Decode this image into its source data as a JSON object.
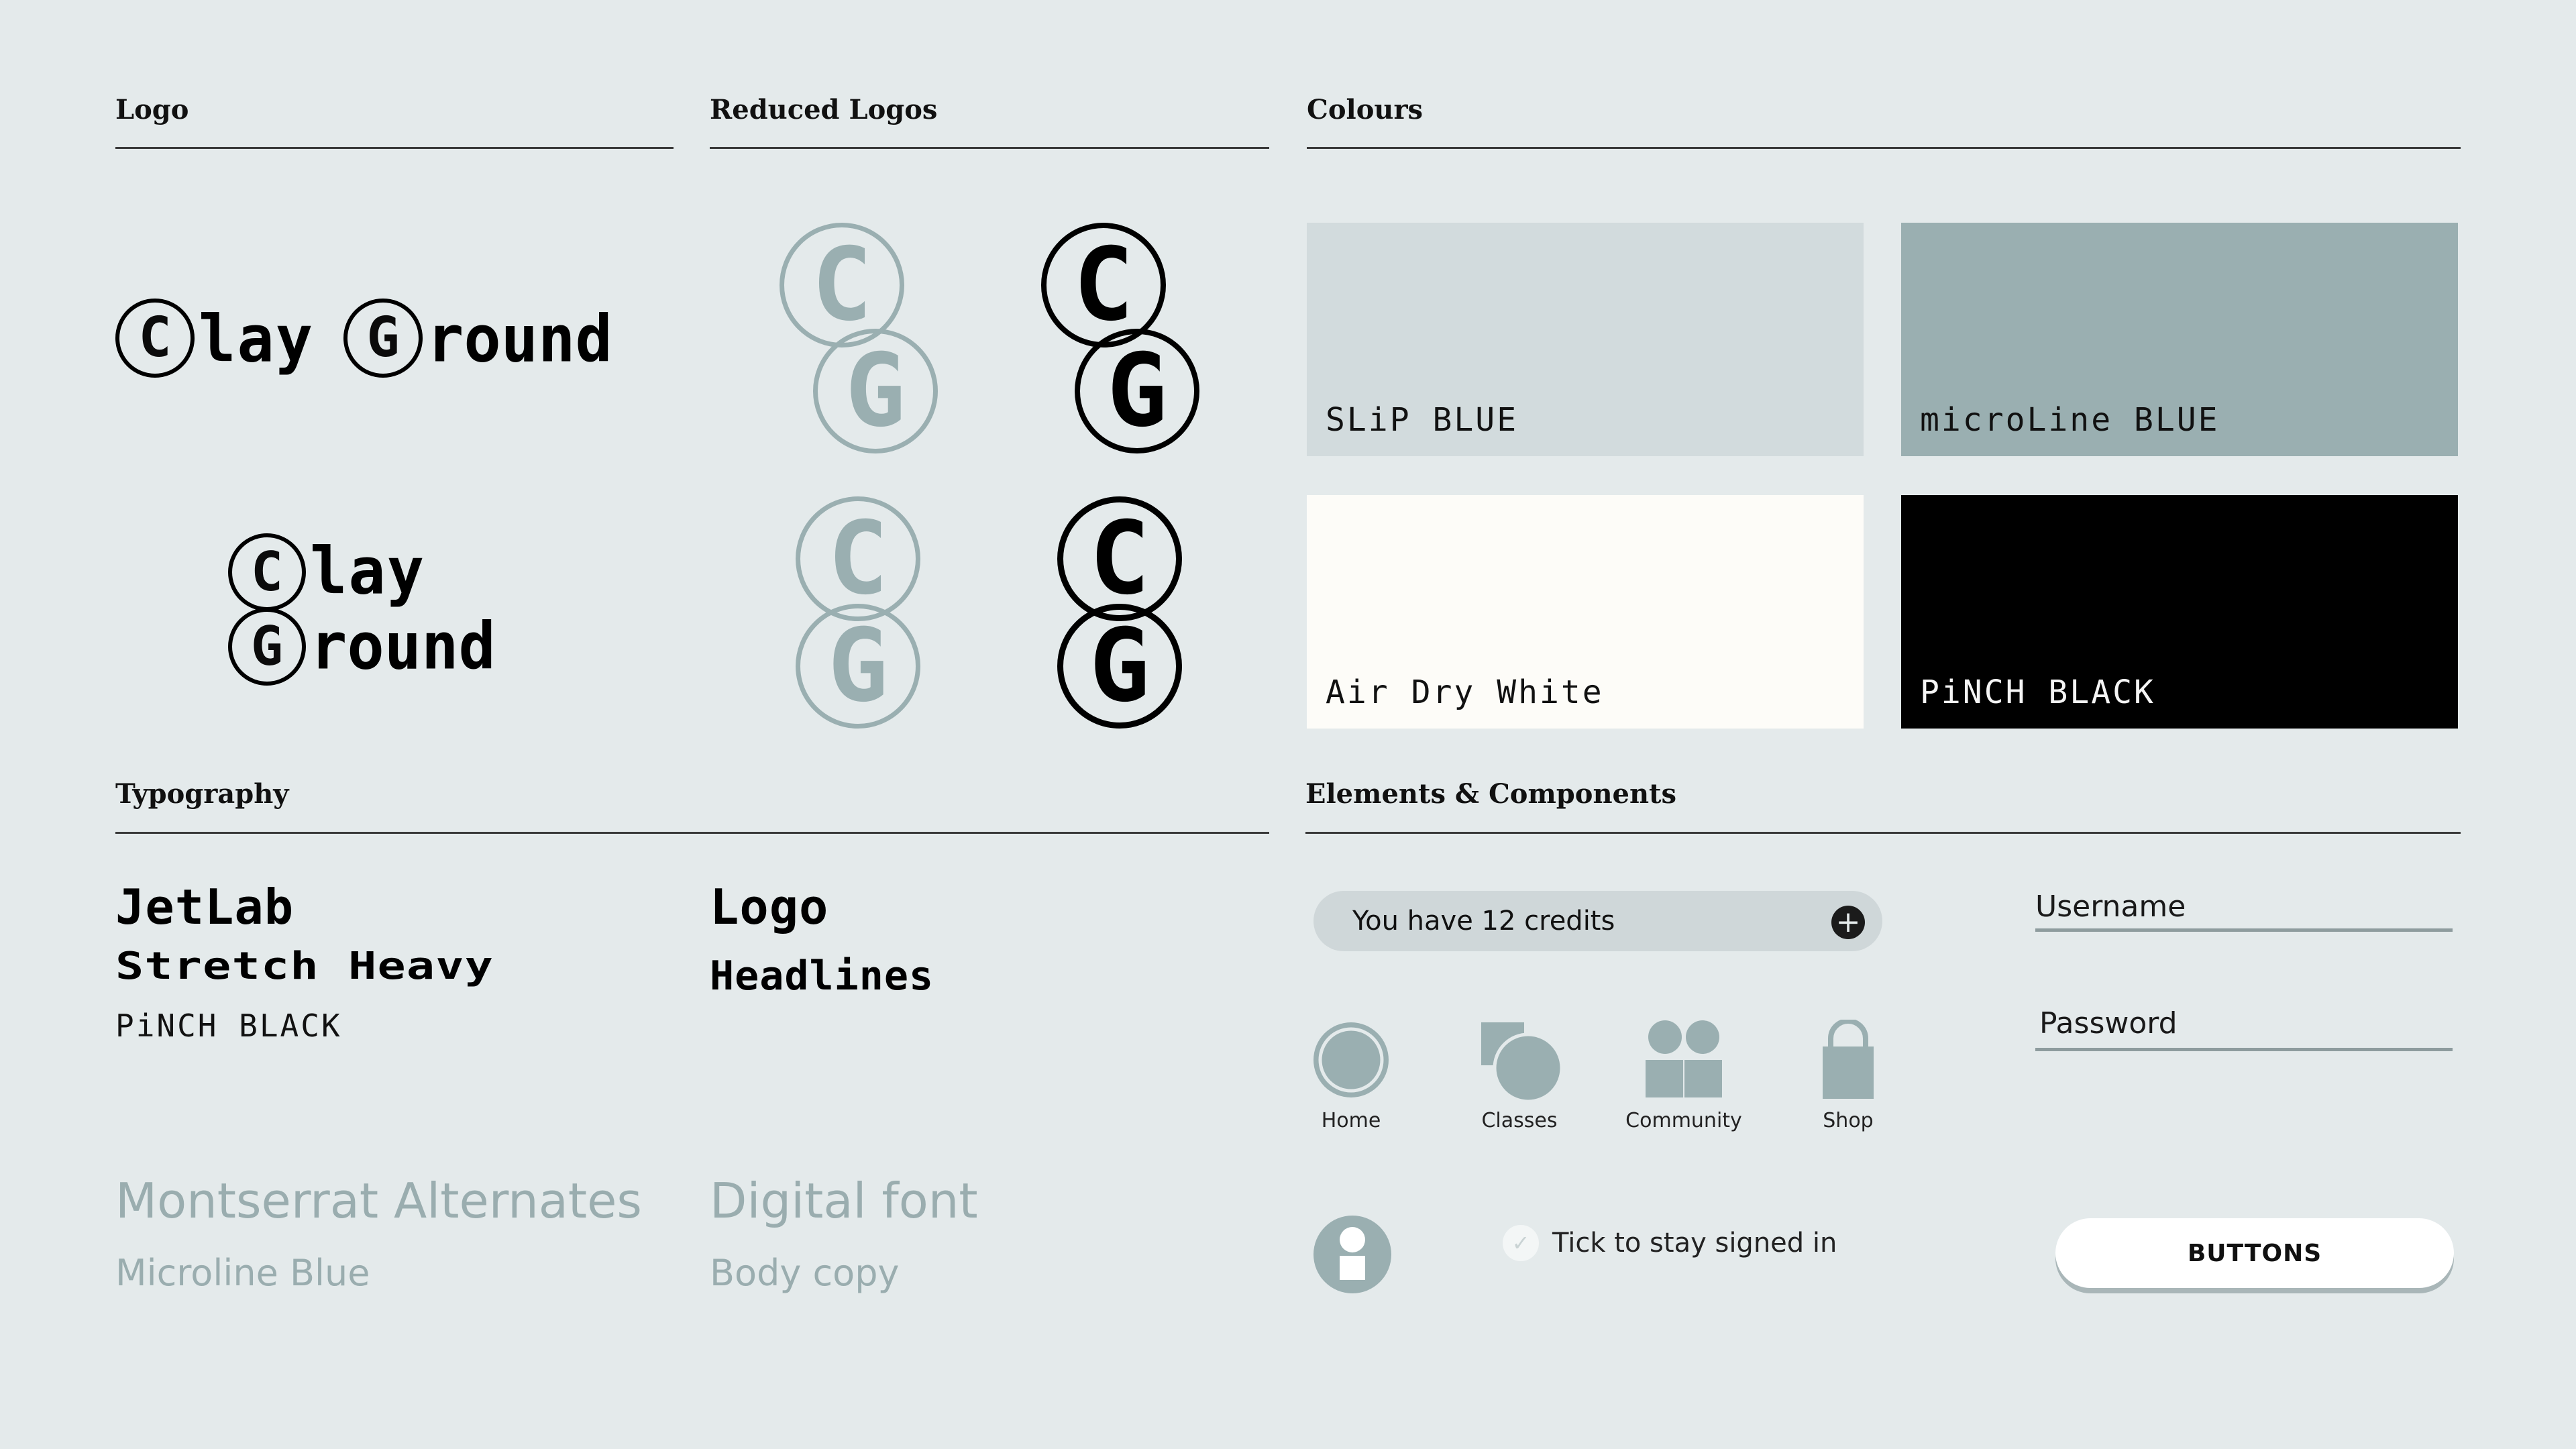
{
  "sections": {
    "logo": "Logo",
    "reduced_logos": "Reduced Logos",
    "colours": "Colours",
    "typography": "Typography",
    "elements": "Elements & Components"
  },
  "logo": {
    "wordmark_one_line": "ClayGround",
    "line1_letter": "C",
    "line1_rest": "lay",
    "line2_letter": "G",
    "line2_rest": "round",
    "monogram_c": "C",
    "monogram_g": "G"
  },
  "colours": [
    {
      "name": "SLiP BLUE",
      "hex": "#d2dbdd",
      "text": "#111111"
    },
    {
      "name": "microLine BLUE",
      "hex": "#9aafb1",
      "text": "#111111"
    },
    {
      "name": "Air Dry White",
      "hex": "#fdfcf8",
      "text": "#111111"
    },
    {
      "name": "PiNCH BLACK",
      "hex": "#000000",
      "text": "#f5f5f5"
    }
  ],
  "typography": {
    "jetlab": "JetLab",
    "stretch_heavy": "Stretch Heavy",
    "pinch_black": "PiNCH BLACK",
    "logo": "Logo",
    "headlines": "Headlines",
    "montserrat": "Montserrat Alternates",
    "microline": "Microline Blue",
    "digital_font": "Digital font",
    "body_copy": "Body copy"
  },
  "components": {
    "credits_text": "You have 12 credits",
    "plus_icon": "plus-icon",
    "username_label": "Username",
    "password_label": "Password",
    "nav": {
      "home": "Home",
      "classes": "Classes",
      "community": "Community",
      "shop": "Shop"
    },
    "checkbox_label": "Tick to stay signed in",
    "button_label": "BUTTONS"
  },
  "palette": {
    "background": "#e4eaeb",
    "accent": "#9aafb1",
    "ink": "#000000"
  }
}
